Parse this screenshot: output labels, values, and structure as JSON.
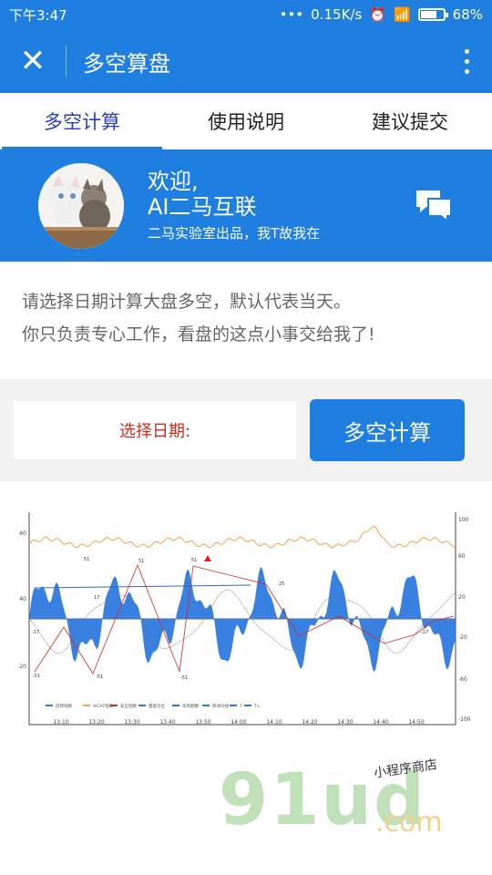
{
  "status_bar": {
    "time": "下午3:47",
    "dots": "•••",
    "network_speed": "0.15K/s",
    "battery": "68%",
    "battery_level": 0.68
  },
  "nav": {
    "title": "多空算盘"
  },
  "tabs": [
    {
      "label": "多空计算",
      "active": true
    },
    {
      "label": "使用说明",
      "active": false
    },
    {
      "label": "建议提交",
      "active": false
    }
  ],
  "profile": {
    "welcome": "欢迎,",
    "company": "AI二马互联",
    "subtitle": "二马实验室出品，我T故我在"
  },
  "intro": {
    "line1": "请选择日期计算大盘多空，默认代表当天。",
    "line2": "你只负责专心工作，看盘的这点小事交给我了!"
  },
  "controls": {
    "date_label": "选择日期:",
    "calc_button": "多空计算"
  },
  "chart_data": {
    "type": "area",
    "x": [
      "13:10",
      "13:20",
      "13:30",
      "13:40",
      "13:50",
      "14:00",
      "14:10",
      "14:20",
      "14:30",
      "14:40",
      "14:50"
    ],
    "left_y_ticks": [
      "60",
      "40",
      "20"
    ],
    "right_y_ticks": [
      "100",
      "60",
      "20",
      "-20",
      "-60",
      "-100"
    ],
    "legend": [
      "反转指数",
      "AICAT指数",
      "安全指数",
      "量能仓位",
      "早周期数",
      "移动均线",
      "T-",
      "T+"
    ],
    "annotations": [
      "51",
      "51",
      "51",
      "25",
      "17",
      "-17",
      "-51",
      "-51",
      "-51",
      "-17"
    ]
  },
  "footer": {
    "logo_main": "91ud",
    "logo_domain": ".com",
    "small_text": "小程序商店"
  },
  "colors": {
    "primary": "#1e7fe0",
    "accent_red": "#d52b1e",
    "chart_orange": "#f1a34a",
    "chart_blue": "#2d79df"
  }
}
